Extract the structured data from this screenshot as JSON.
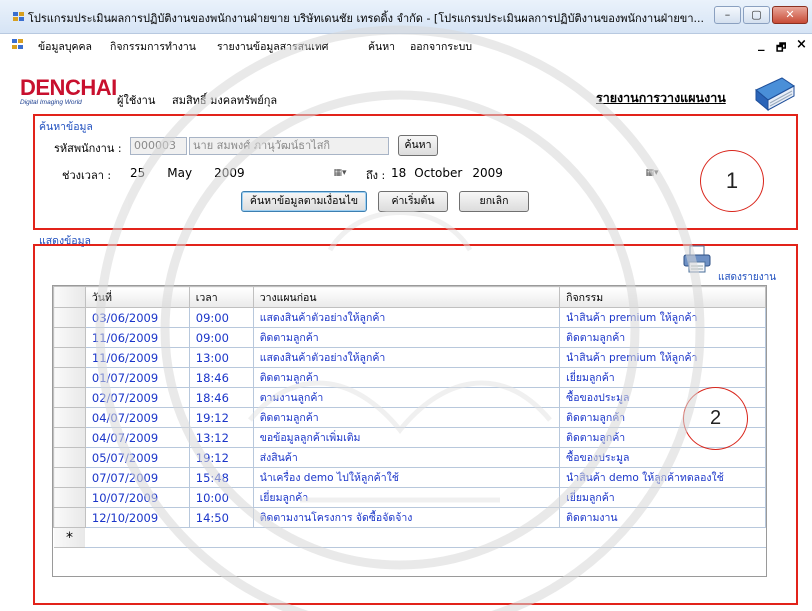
{
  "window": {
    "title": "โปรแกรมประเมินผลการปฏิบัติงานของพนักงานฝ่ายขาย บริษัทเดนชัย เทรดดิ้ง จำกัด - [โปรแกรมประเมินผลการปฏิบัติงานของพนักงานฝ่ายขา...",
    "min_label": "–",
    "max_label": "▢",
    "close_label": "✕"
  },
  "menu": {
    "items": [
      "ข้อมูลบุคคล",
      "กิจกรรมการทำงาน",
      "รายงานข้อมูลสารสนเทศ",
      "ค้นหา",
      "ออกจากระบบ"
    ],
    "mdi_min": "_",
    "mdi_max": "🗗",
    "mdi_close": "×"
  },
  "header": {
    "logo_main": "DENCHAI",
    "logo_sub": "Digital Imaging World",
    "user_label": "ผู้ใช้งาน",
    "user_name": "สมสิทธิ์ มงคลทรัพย์กุล",
    "report_title": "รายงานการวางแผนงาน"
  },
  "search": {
    "group_title": "ค้นหาข้อมูล",
    "emp_label": "รหัสพนักงาน :",
    "emp_code": "000003",
    "emp_name": "นาย สมพงศ์ ภานุวัฒน์ธาไสกิ",
    "find_button": "ค้นหา",
    "period_label": "ช่วงเวลา :",
    "from_day": "25",
    "from_month": "May",
    "from_year": "2009",
    "to_label": "ถึง :",
    "to_day": "18",
    "to_month": "October",
    "to_year": "2009",
    "search_condition_button": "ค้นหาข้อมูลตามเงื่อนไข",
    "reset_button": "ค่าเริ่มต้น",
    "cancel_button": "ยกเลิก",
    "annotation": "1"
  },
  "display": {
    "group_title": "แสดงข้อมูล",
    "print_label": "แสดงรายงาน",
    "annotation": "2",
    "columns": [
      "วันที่",
      "เวลา",
      "วางแผนก่อน",
      "กิจกรรม"
    ],
    "rows": [
      [
        "03/06/2009",
        "09:00",
        "แสดงสินค้าตัวอย่างให้ลูกค้า",
        "นำสินค้า premium ให้ลูกค้า"
      ],
      [
        "11/06/2009",
        "09:00",
        "ติดตามลูกค้า",
        "ติดตามลูกค้า"
      ],
      [
        "11/06/2009",
        "13:00",
        "แสดงสินค้าตัวอย่างให้ลูกค้า",
        "นำสินค้า premium ให้ลูกค้า"
      ],
      [
        "01/07/2009",
        "18:46",
        "ติดตามลูกค้า",
        "เยี่ยมลูกค้า"
      ],
      [
        "02/07/2009",
        "18:46",
        "ตามงานลูกค้า",
        "ซื้อของประมูล"
      ],
      [
        "04/07/2009",
        "19:12",
        "ติดตามลูกค้า",
        "ติดตามลูกค้า"
      ],
      [
        "04/07/2009",
        "13:12",
        "ขอข้อมูลลูกค้าเพิ่มเติม",
        "ติดตามลูกค้า"
      ],
      [
        "05/07/2009",
        "19:12",
        "ส่งสินค้า",
        "ซื้อของประมูล"
      ],
      [
        "07/07/2009",
        "15:48",
        "นำเครื่อง demo ไปให้ลูกค้าใช้",
        "นำสินค้า demo ให้ลูกค้าทดลองใช้"
      ],
      [
        "10/07/2009",
        "10:00",
        "เยี่ยมลูกค้า",
        "เยี่ยมลูกค้า"
      ],
      [
        "12/10/2009",
        "14:50",
        "ติดตามงานโครงการ จัดซื้อจัดจ้าง",
        "ติดตามงาน"
      ]
    ],
    "new_row_marker": "*"
  },
  "colors": {
    "annotation_red": "#e2231a",
    "link_blue": "#1a35c9",
    "group_title_blue": "#1f4fbf",
    "logo_red": "#c8102e"
  },
  "icons": [
    "app-icon",
    "mdi-child-icon",
    "book-report-icon",
    "printer-icon",
    "calendar-dropdown-icon"
  ]
}
